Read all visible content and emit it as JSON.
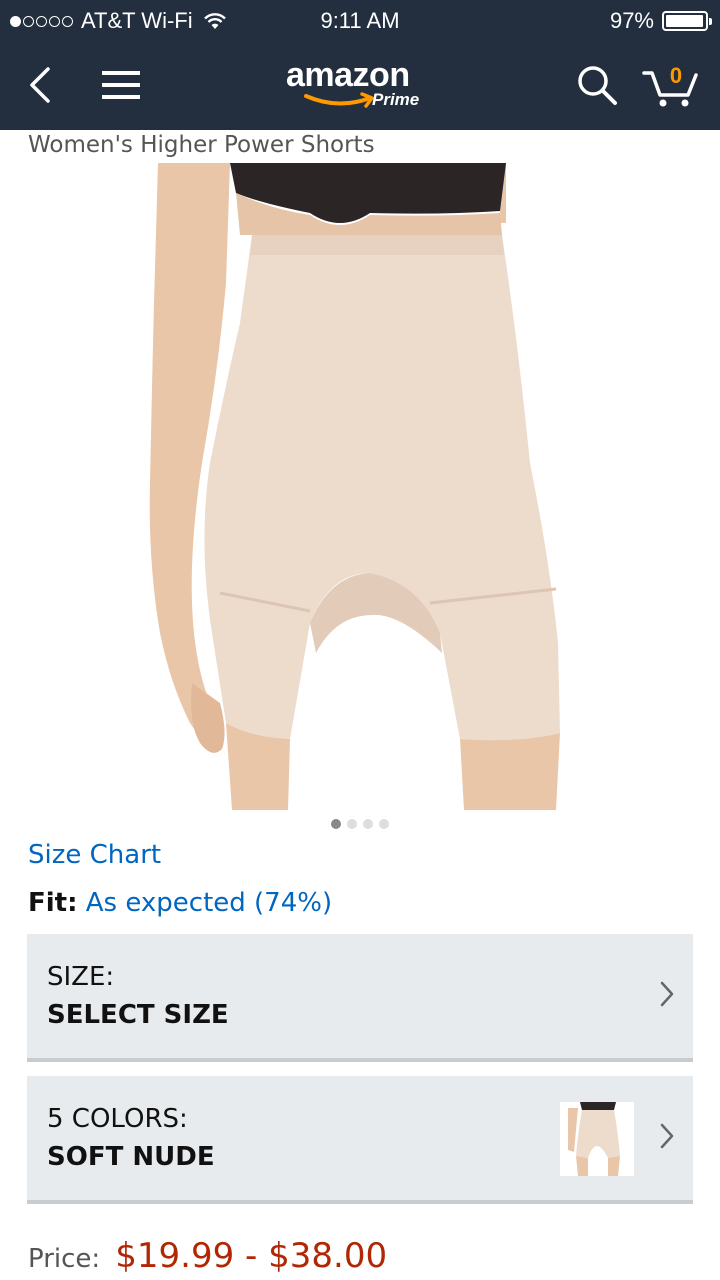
{
  "status_bar": {
    "carrier": "AT&T Wi-Fi",
    "time": "9:11 AM",
    "battery": "97%",
    "battery_level": 0.97,
    "signal_bars_filled": 1,
    "signal_bars_total": 5
  },
  "nav": {
    "logo_text": "amazon",
    "logo_sub": "Prime",
    "cart_count": "0",
    "icons": [
      "back-chevron-icon",
      "hamburger-menu-icon",
      "search-icon",
      "cart-icon"
    ]
  },
  "product": {
    "title": "Women's Higher Power Shorts",
    "image_count": 4,
    "active_image": 1,
    "size_chart_label": "Size Chart",
    "fit_label": "Fit:",
    "fit_value": "As expected (74%)"
  },
  "size_selector": {
    "label": "SIZE:",
    "value": "SELECT SIZE"
  },
  "color_selector": {
    "label": "5 COLORS:",
    "value": "SOFT NUDE"
  },
  "price": {
    "label": "Price:",
    "value": "$19.99 - $38.00"
  },
  "colors": {
    "header_bg": "#232f3e",
    "link": "#0066c0",
    "price": "#b12704",
    "smile": "#ff9900",
    "selector_bg": "#e8ebed"
  }
}
